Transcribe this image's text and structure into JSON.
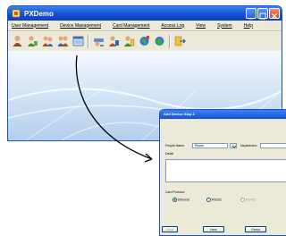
{
  "window": {
    "title": "PXDemo",
    "colors": {
      "titlebar": "#1551d8",
      "menubar": "#ece9d8",
      "close": "#d2482c"
    }
  },
  "menu": [
    {
      "label": "User Management"
    },
    {
      "label": "Device Management"
    },
    {
      "label": "Card Management"
    },
    {
      "label": "Access Log"
    },
    {
      "label": "View"
    },
    {
      "label": "System"
    },
    {
      "label": "Help"
    }
  ],
  "toolbar_icons": [
    "user-icon",
    "user-group-icon",
    "users-search-icon",
    "card-users-icon",
    "card-list-icon",
    "reader-icon",
    "reader-user-icon",
    "reader-key-icon",
    "globe-icon",
    "globe-green-icon",
    "export-icon"
  ],
  "dialog": {
    "title": "Add Device Step 1",
    "people_name_label": "People Name",
    "people_name_value": "Phone",
    "department_label": "Department",
    "detail_label": "Detail",
    "card_format_label": "Card Protocol",
    "radio_options": [
      {
        "label": "Ethernet",
        "selected": true
      },
      {
        "label": "RS232",
        "selected": false
      },
      {
        "label": "RS485",
        "selected": false,
        "disabled": true
      }
    ],
    "buttons": {
      "back": "Back",
      "next": "Next",
      "finish": "Finish"
    }
  }
}
